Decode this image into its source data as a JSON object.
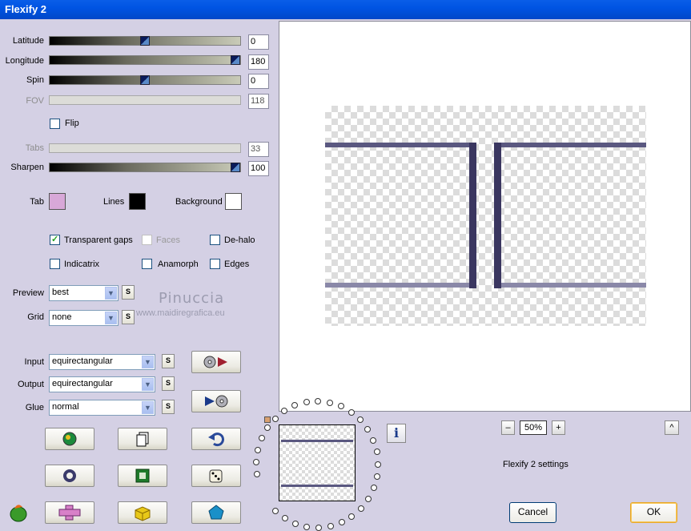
{
  "window": {
    "title": "Flexify 2"
  },
  "sliders": {
    "latitude": {
      "label": "Latitude",
      "value": "0",
      "fraction": 0.5
    },
    "longitude": {
      "label": "Longitude",
      "value": "180",
      "fraction": 1.0
    },
    "spin": {
      "label": "Spin",
      "value": "0",
      "fraction": 0.5
    },
    "fov": {
      "label": "FOV",
      "value": "118"
    },
    "tabs": {
      "label": "Tabs",
      "value": "33"
    },
    "sharpen": {
      "label": "Sharpen",
      "value": "100",
      "fraction": 1.0
    }
  },
  "flip": {
    "label": "Flip",
    "checked": false
  },
  "colors": {
    "tab": {
      "label": "Tab",
      "value": "#d8a8d8"
    },
    "lines": {
      "label": "Lines",
      "value": "#000000"
    },
    "background": {
      "label": "Background",
      "value": "#ffffff"
    },
    "frame": "#3a3660"
  },
  "options": {
    "transparent_gaps": {
      "label": "Transparent gaps",
      "checked": true
    },
    "faces": {
      "label": "Faces",
      "checked": false
    },
    "de_halo": {
      "label": "De-halo",
      "checked": false
    },
    "indicatrix": {
      "label": "Indicatrix",
      "checked": false
    },
    "anamorph": {
      "label": "Anamorph",
      "checked": false
    },
    "edges": {
      "label": "Edges",
      "checked": false
    }
  },
  "dropdowns": {
    "preview": {
      "label": "Preview",
      "value": "best"
    },
    "grid": {
      "label": "Grid",
      "value": "none"
    },
    "input": {
      "label": "Input",
      "value": "equirectangular"
    },
    "output": {
      "label": "Output",
      "value": "equirectangular"
    },
    "glue": {
      "label": "Glue",
      "value": "normal"
    },
    "s_label": "S"
  },
  "watermark": {
    "name": "Pinuccia",
    "url": "www.maidiregrafica.eu"
  },
  "zoom": {
    "minus": "–",
    "value": "50%",
    "plus": "+",
    "collapse": "^"
  },
  "status": "Flexify 2 settings",
  "buttons": {
    "cancel": "Cancel",
    "ok": "OK"
  }
}
